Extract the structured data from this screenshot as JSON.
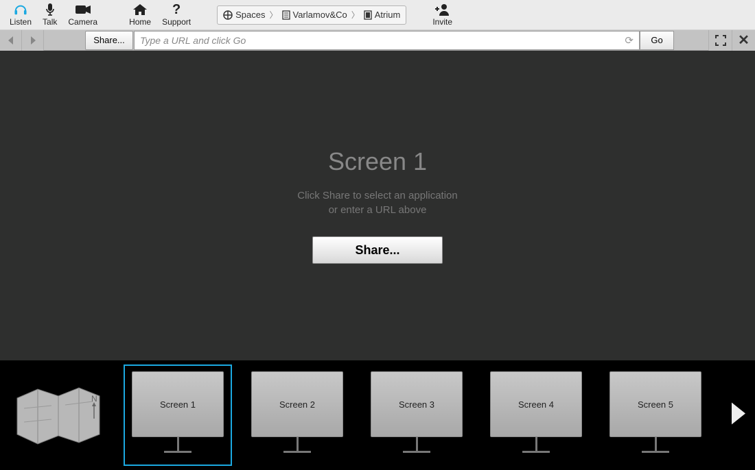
{
  "toolbar": {
    "listen": "Listen",
    "talk": "Talk",
    "camera": "Camera",
    "home": "Home",
    "support": "Support",
    "invite": "Invite"
  },
  "breadcrumb": {
    "root": "Spaces",
    "org": "Varlamov&Co",
    "room": "Atrium"
  },
  "navbar": {
    "share": "Share...",
    "url_placeholder": "Type a URL and click Go",
    "go": "Go"
  },
  "stage": {
    "title": "Screen 1",
    "sub1": "Click Share to select an application",
    "sub2": "or enter a URL above",
    "share": "Share..."
  },
  "tray": {
    "screens": [
      {
        "label": "Screen 1",
        "selected": true
      },
      {
        "label": "Screen 2",
        "selected": false
      },
      {
        "label": "Screen 3",
        "selected": false
      },
      {
        "label": "Screen 4",
        "selected": false
      },
      {
        "label": "Screen 5",
        "selected": false
      }
    ]
  }
}
